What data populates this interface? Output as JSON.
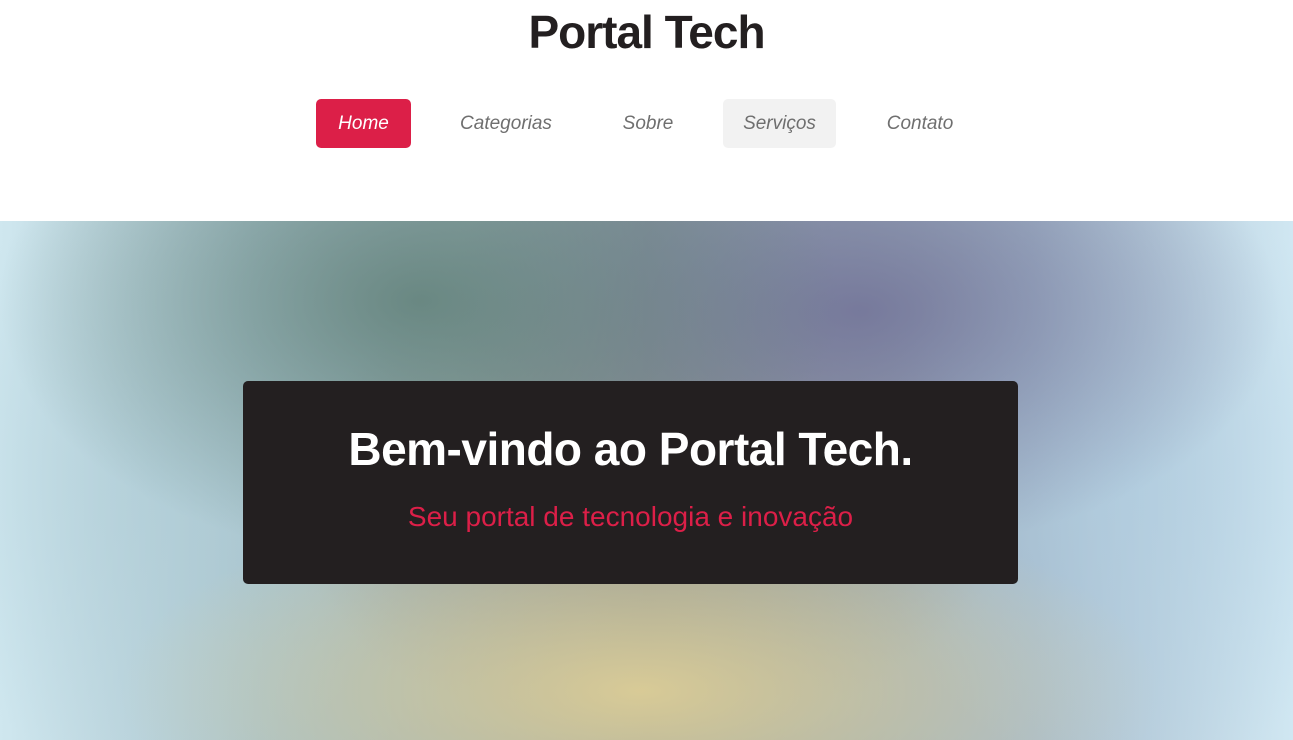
{
  "site": {
    "title": "Portal Tech"
  },
  "nav": {
    "items": [
      {
        "label": "Home",
        "state": "active"
      },
      {
        "label": "Categorias",
        "state": "default"
      },
      {
        "label": "Sobre",
        "state": "default"
      },
      {
        "label": "Serviços",
        "state": "hover"
      },
      {
        "label": "Contato",
        "state": "default"
      }
    ]
  },
  "hero": {
    "title": "Bem-vindo ao Portal Tech.",
    "subtitle": "Seu portal de tecnologia e inovação"
  },
  "colors": {
    "accent": "#dc1f48",
    "dark": "#231f20",
    "nav_text": "#6f6f6f",
    "nav_hover_bg": "#f2f2f2"
  }
}
